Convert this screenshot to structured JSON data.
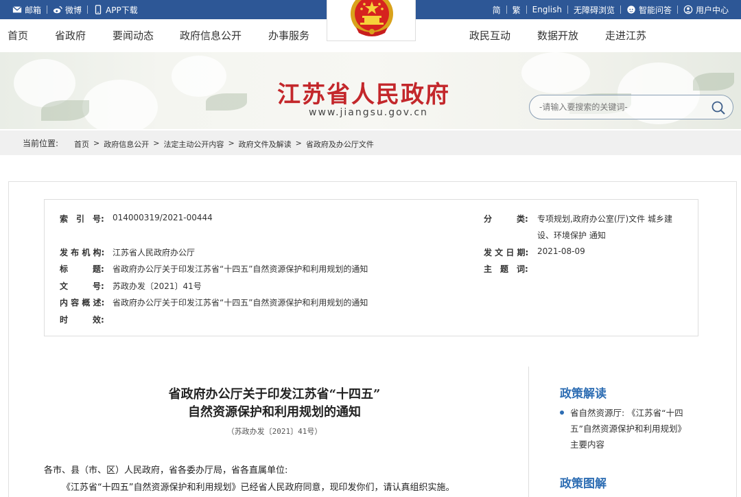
{
  "topbar": {
    "mail": "邮箱",
    "weibo": "微博",
    "app": "APP下载",
    "simplified": "简",
    "traditional": "繁",
    "english": "English",
    "accessible": "无障碍浏览",
    "qa": "智能问答",
    "user": "用户中心"
  },
  "nav": {
    "items": [
      "首页",
      "省政府",
      "要闻动态",
      "政府信息公开",
      "办事服务",
      "政民互动",
      "数据开放",
      "走进江苏"
    ]
  },
  "banner": {
    "title": "江苏省人民政府",
    "url": "www.jiangsu.gov.cn",
    "search_placeholder": "-请输入要搜索的关键词-"
  },
  "breadcrumb": {
    "label": "当前位置:",
    "items": [
      "首页",
      "政府信息公开",
      "法定主动公开内容",
      "政府文件及解读",
      "省政府及办公厅文件"
    ],
    "separator": ">"
  },
  "meta": {
    "index_label": "索　引　号:",
    "index_value": "014000319/2021-00444",
    "category_label": "分　　　类:",
    "category_value_1": "专项规划,政府办公室(厅)文件 城乡建",
    "category_value_2": "设、环境保护 通知",
    "issuer_label": "发 布 机 构:",
    "issuer_value": "江苏省人民政府办公厅",
    "date_label": "发 文 日 期:",
    "date_value": "2021-08-09",
    "title_label": "标　　　题:",
    "title_value": "省政府办公厅关于印发江苏省“十四五”自然资源保护和利用规划的通知",
    "subject_label": "主　题　词:",
    "subject_value": "",
    "docno_label": "文　　　号:",
    "docno_value": "苏政办发〔2021〕41号",
    "summary_label": "内 容 概 述:",
    "summary_value": "省政府办公厅关于印发江苏省“十四五”自然资源保护和利用规划的通知",
    "validity_label": "时　　　效:",
    "validity_value": ""
  },
  "document": {
    "title_line1": "省政府办公厅关于印发江苏省“十四五”",
    "title_line2": "自然资源保护和利用规划的通知",
    "number": "（苏政办发〔2021〕41号）",
    "recipients": "各市、县（市、区）人民政府，省各委办厅局，省各直属单位:",
    "para1": "《江苏省“十四五”自然资源保护和利用规划》已经省人民政府同意，现印发你们，请认真组织实施。"
  },
  "sidebar": {
    "section1_title": "政策解读",
    "section1_link": "省自然资源厅: 《江苏省“十四五”自然资源保护和利用规划》主要内容",
    "section2_title": "政策图解"
  },
  "colors": {
    "topbar": "#2d5796",
    "title_red": "#c3272b",
    "accent_blue": "#2d6db3"
  }
}
